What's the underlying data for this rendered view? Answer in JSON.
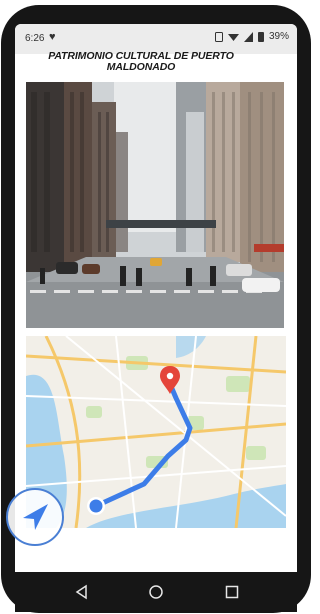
{
  "status_bar": {
    "time": "6:26",
    "battery": "39%",
    "icons": [
      "heart-icon",
      "screen-icon",
      "wifi-icon",
      "signal-icon",
      "battery-icon"
    ]
  },
  "page": {
    "title": "PATRIMONIO CULTURAL DE PUERTO MALDONADO"
  },
  "images": {
    "city": "city-street-photo",
    "map": "route-map"
  },
  "controls": {
    "navigation_icon": "navigation-arrow-icon"
  },
  "android_nav": {
    "back": "back-triangle-icon",
    "home": "home-circle-icon",
    "recents": "recents-square-icon"
  },
  "colors": {
    "route": "#3d7de8",
    "pin": "#e4453a",
    "water": "#a9d3ef",
    "accent": "#4a7fd4"
  }
}
